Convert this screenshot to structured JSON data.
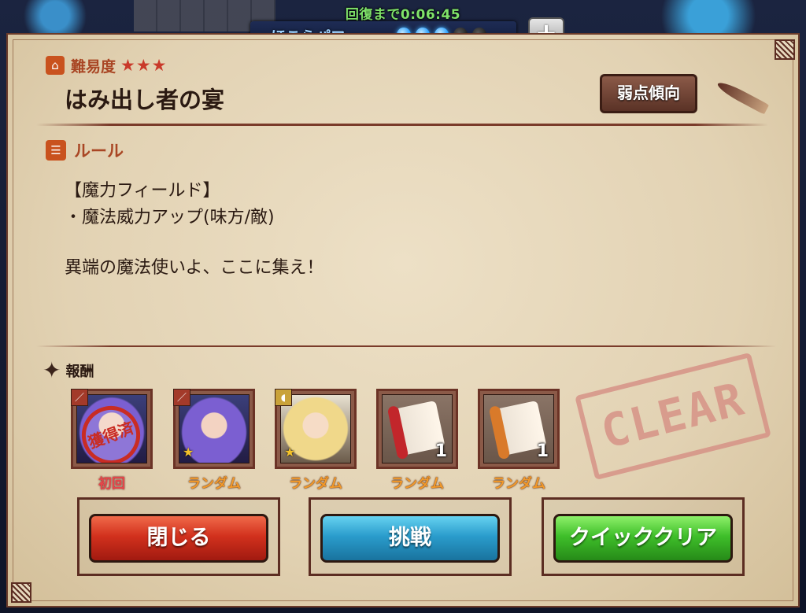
{
  "hud": {
    "recovery_text": "回復まで0:06:45",
    "power_label": "ほこらパワー",
    "power_pips": [
      true,
      true,
      true,
      false,
      false
    ],
    "plus_label": "+"
  },
  "quest": {
    "difficulty_label": "難易度",
    "difficulty_stars": "★★★",
    "title": "はみ出し者の宴",
    "weakness_button": "弱点傾向"
  },
  "rules": {
    "label": "ルール",
    "lines": [
      "【魔力フィールド】",
      "・魔法威力アップ(味方/敵)",
      "",
      "異端の魔法使いよ、ここに集え！"
    ]
  },
  "rewards": {
    "label": "報酬",
    "items": [
      {
        "kind": "character",
        "stamp": "獲得済",
        "caption": "初回"
      },
      {
        "kind": "character",
        "star": "★",
        "caption": "ランダム"
      },
      {
        "kind": "character",
        "star": "★",
        "caption": "ランダム"
      },
      {
        "kind": "scroll",
        "count": "1",
        "caption": "ランダム"
      },
      {
        "kind": "scroll",
        "count": "1",
        "caption": "ランダム"
      }
    ]
  },
  "clear_stamp": "CLEAR",
  "buttons": {
    "close": "閉じる",
    "challenge": "挑戦",
    "quick_clear": "クイッククリア"
  },
  "colors": {
    "accent_red": "#c9521e",
    "parchment": "#e2d2b3",
    "power_blue": "#2aa0ff",
    "recovery_green": "#7fe36a"
  }
}
